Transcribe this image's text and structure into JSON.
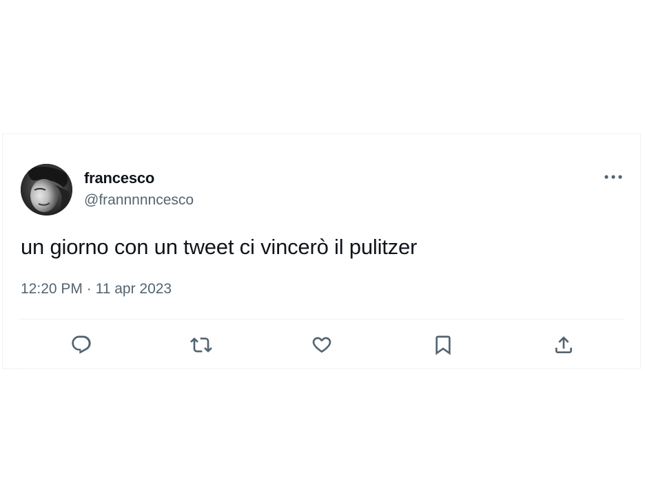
{
  "tweet": {
    "display_name": "francesco",
    "handle": "@frannnnncesco",
    "text": "un giorno con un tweet ci vincerò il pulitzer",
    "time": "12:20 PM",
    "separator": "·",
    "date": "11 apr 2023"
  },
  "icons": {
    "more": "more-horizontal-icon",
    "reply": "reply-icon",
    "retweet": "retweet-icon",
    "like": "heart-icon",
    "bookmark": "bookmark-icon",
    "share": "share-icon"
  },
  "colors": {
    "text_primary": "#0f1419",
    "text_secondary": "#536471",
    "divider": "#eff3f4"
  }
}
